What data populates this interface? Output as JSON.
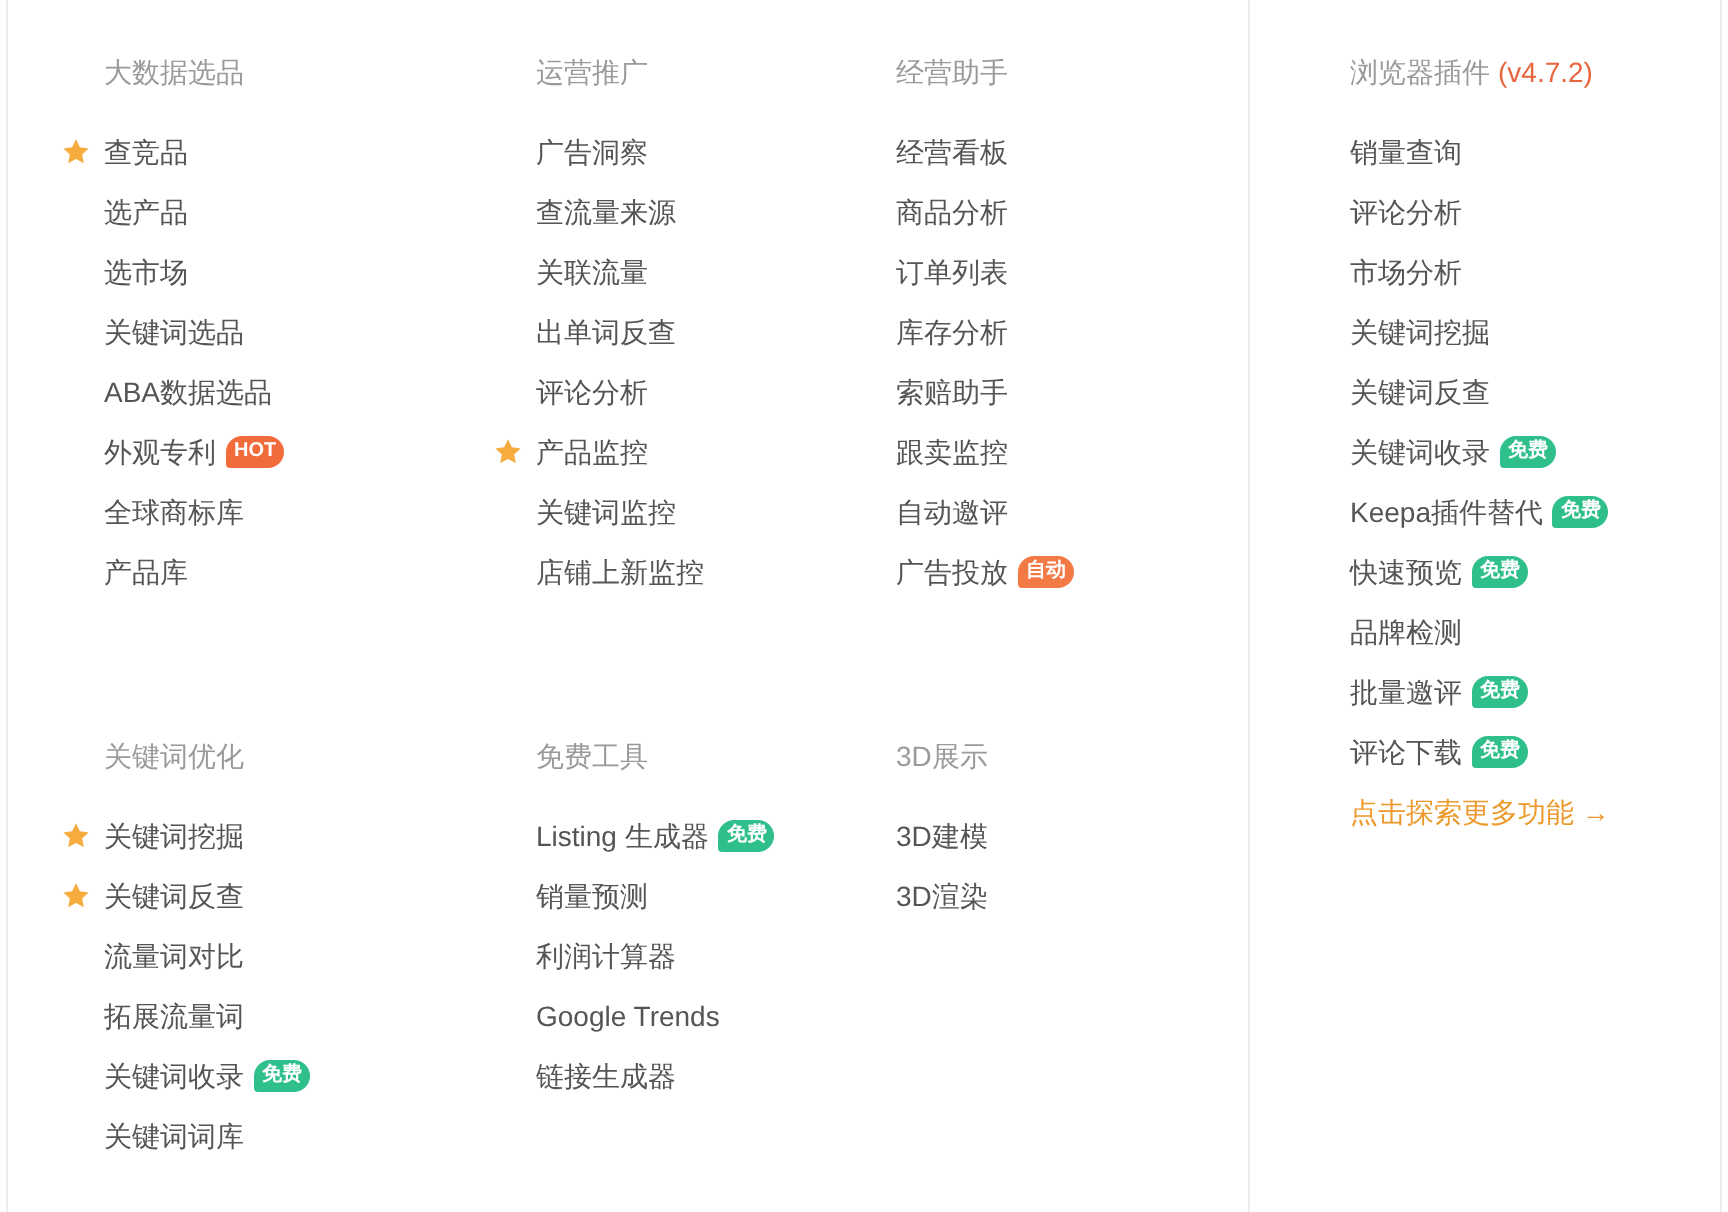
{
  "sections": [
    {
      "groups": [
        {
          "title": "大数据选品",
          "items": [
            {
              "label": "查竞品",
              "starred": true
            },
            {
              "label": "选产品",
              "starred": false
            },
            {
              "label": "选市场",
              "starred": false
            },
            {
              "label": "关键词选品",
              "starred": false
            },
            {
              "label": "ABA数据选品",
              "starred": false
            },
            {
              "label": "外观专利",
              "starred": false,
              "badge": {
                "label": "HOT",
                "color": "#f26b3b"
              }
            },
            {
              "label": "全球商标库",
              "starred": false
            },
            {
              "label": "产品库",
              "starred": false
            }
          ]
        },
        {
          "title": "运营推广",
          "items": [
            {
              "label": "广告洞察",
              "starred": false
            },
            {
              "label": "查流量来源",
              "starred": false
            },
            {
              "label": "关联流量",
              "starred": false
            },
            {
              "label": "出单词反查",
              "starred": false
            },
            {
              "label": "评论分析",
              "starred": false
            },
            {
              "label": "产品监控",
              "starred": true
            },
            {
              "label": "关键词监控",
              "starred": false
            },
            {
              "label": "店铺上新监控",
              "starred": false
            }
          ]
        },
        {
          "title": "经营助手",
          "items": [
            {
              "label": "经营看板",
              "starred": false
            },
            {
              "label": "商品分析",
              "starred": false
            },
            {
              "label": "订单列表",
              "starred": false
            },
            {
              "label": "库存分析",
              "starred": false
            },
            {
              "label": "索赔助手",
              "starred": false
            },
            {
              "label": "跟卖监控",
              "starred": false
            },
            {
              "label": "自动邀评",
              "starred": false
            },
            {
              "label": "广告投放",
              "starred": false,
              "badge": {
                "label": "自动",
                "color": "#f47a45"
              }
            }
          ]
        }
      ]
    },
    {
      "groups": [
        {
          "title": "关键词优化",
          "items": [
            {
              "label": "关键词挖掘",
              "starred": true
            },
            {
              "label": "关键词反查",
              "starred": true
            },
            {
              "label": "流量词对比",
              "starred": false
            },
            {
              "label": "拓展流量词",
              "starred": false
            },
            {
              "label": "关键词收录",
              "starred": false,
              "badge": {
                "label": "免费",
                "color": "#2fbf8b"
              }
            },
            {
              "label": "关键词词库",
              "starred": false
            }
          ]
        },
        {
          "title": "免费工具",
          "items": [
            {
              "label": "Listing 生成器",
              "starred": false,
              "badge": {
                "label": "免费",
                "color": "#2fbf8b"
              }
            },
            {
              "label": "销量预测",
              "starred": false
            },
            {
              "label": "利润计算器",
              "starred": false
            },
            {
              "label": "Google Trends",
              "starred": false
            },
            {
              "label": "链接生成器",
              "starred": false
            }
          ]
        },
        {
          "title": "3D展示",
          "items": [
            {
              "label": "3D建模",
              "starred": false
            },
            {
              "label": "3D渲染",
              "starred": false
            }
          ]
        }
      ]
    }
  ],
  "plugin": {
    "title": "浏览器插件",
    "version": "(v4.7.2)",
    "items": [
      {
        "label": "销量查询"
      },
      {
        "label": "评论分析"
      },
      {
        "label": "市场分析"
      },
      {
        "label": "关键词挖掘"
      },
      {
        "label": "关键词反查"
      },
      {
        "label": "关键词收录",
        "badge": {
          "label": "免费",
          "color": "#2fbf8b"
        }
      },
      {
        "label": "Keepa插件替代",
        "badge": {
          "label": "免费",
          "color": "#2fbf8b"
        }
      },
      {
        "label": "快速预览",
        "badge": {
          "label": "免费",
          "color": "#2fbf8b"
        }
      },
      {
        "label": "品牌检测"
      },
      {
        "label": "批量邀评",
        "badge": {
          "label": "免费",
          "color": "#2fbf8b"
        }
      },
      {
        "label": "评论下载",
        "badge": {
          "label": "免费",
          "color": "#2fbf8b"
        }
      }
    ],
    "more_link": "点击探索更多功能 →"
  }
}
